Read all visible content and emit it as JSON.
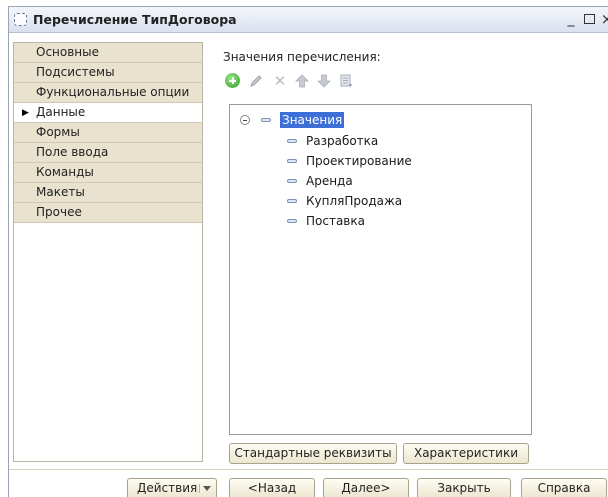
{
  "window": {
    "title": "Перечисление ТипДоговора",
    "controls": {
      "minimize": "_",
      "close": "×"
    }
  },
  "sections": {
    "items": [
      {
        "label": "Основные",
        "active": false
      },
      {
        "label": "Подсистемы",
        "active": false
      },
      {
        "label": "Функциональные опции",
        "active": false
      },
      {
        "label": "Данные",
        "active": true
      },
      {
        "label": "Формы",
        "active": false
      },
      {
        "label": "Поле ввода",
        "active": false
      },
      {
        "label": "Команды",
        "active": false
      },
      {
        "label": "Макеты",
        "active": false
      },
      {
        "label": "Прочее",
        "active": false
      }
    ],
    "active_marker": "▶"
  },
  "main": {
    "values_label": "Значения перечисления:",
    "toolbar": {
      "icons": [
        "add-icon",
        "edit-icon",
        "delete-icon",
        "move-up-icon",
        "move-down-icon",
        "list-icon"
      ],
      "delete_glyph": "✕"
    },
    "tree": {
      "root": "Значения",
      "children": [
        "Разработка",
        "Проектирование",
        "Аренда",
        "КупляПродажа",
        "Поставка"
      ]
    },
    "buttons": {
      "standard_attrs": "Стандартные реквизиты",
      "characteristics": "Характеристики"
    }
  },
  "footer": {
    "actions": "Действия",
    "back": "<Назад",
    "next": "Далее>",
    "close": "Закрыть",
    "help": "Справка"
  },
  "colors": {
    "section_bg": "#e8e2cf",
    "selection": "#3d6fd8",
    "add_green": "#2e9d2a"
  }
}
